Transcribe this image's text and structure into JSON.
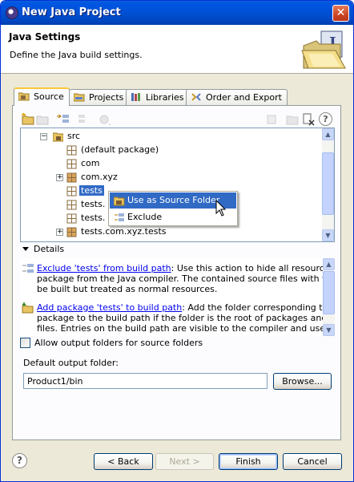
{
  "window": {
    "title": "New Java Project"
  },
  "header": {
    "title": "Java Settings",
    "description": "Define the Java build settings."
  },
  "tabs": [
    {
      "label": "Source"
    },
    {
      "label": "Projects"
    },
    {
      "label": "Libraries"
    },
    {
      "label": "Order and Export"
    }
  ],
  "tree": {
    "items": [
      {
        "label": "src"
      },
      {
        "label": "(default package)"
      },
      {
        "label": "com"
      },
      {
        "label": "com.xyz"
      },
      {
        "label": "tests"
      },
      {
        "label": "tests."
      },
      {
        "label": "tests."
      },
      {
        "label": "tests.com.xyz.tests"
      }
    ]
  },
  "context_menu": {
    "items": [
      {
        "label": "Use as Source Folder"
      },
      {
        "label": "Exclude"
      }
    ]
  },
  "details": {
    "toggle_label": "Details",
    "entry1": {
      "link": "Exclude 'tests' from build path",
      "line1": ": Use this action to hide all resources in th",
      "line2": "package from the Java compiler. The contained source files with will no",
      "line3": "be built but treated as normal resources."
    },
    "entry2": {
      "link": "Add package 'tests' to build path",
      "line1": ": Add the folder corresponding to the",
      "line2": "package to the build path if the folder is the root of packages and sour",
      "line3": "files. Entries on the build path are visible to the compiler and used for"
    }
  },
  "options": {
    "allow_output_folders": "Allow output folders for source folders"
  },
  "output": {
    "label": "Default output folder:",
    "value": "Product1/bin",
    "browse": "Browse..."
  },
  "buttons": {
    "back": "< Back",
    "next": "Next >",
    "finish": "Finish",
    "cancel": "Cancel"
  }
}
